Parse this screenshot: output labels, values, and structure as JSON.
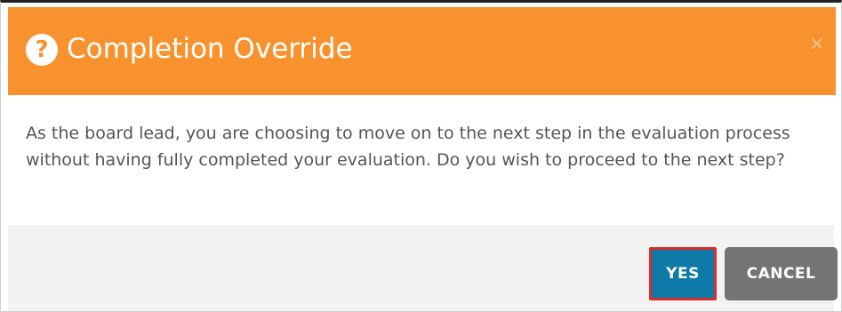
{
  "dialog": {
    "title": "Completion Override",
    "help_icon_glyph": "?",
    "close_glyph": "×",
    "message": "As the board lead, you are choosing to move on to the next step in the evaluation process without having fully completed your evaluation. Do you wish to proceed to the next step?",
    "buttons": {
      "yes_label": "YES",
      "cancel_label": "CANCEL"
    }
  },
  "colors": {
    "header_bg": "#F7922E",
    "yes_bg": "#0F7AA8",
    "yes_highlight_border": "#D92C2C",
    "cancel_bg": "#747474",
    "footer_bg": "#F2F2F2",
    "message_text": "#555555"
  },
  "icons": {
    "help": "question-circle-icon",
    "close": "close-icon"
  }
}
